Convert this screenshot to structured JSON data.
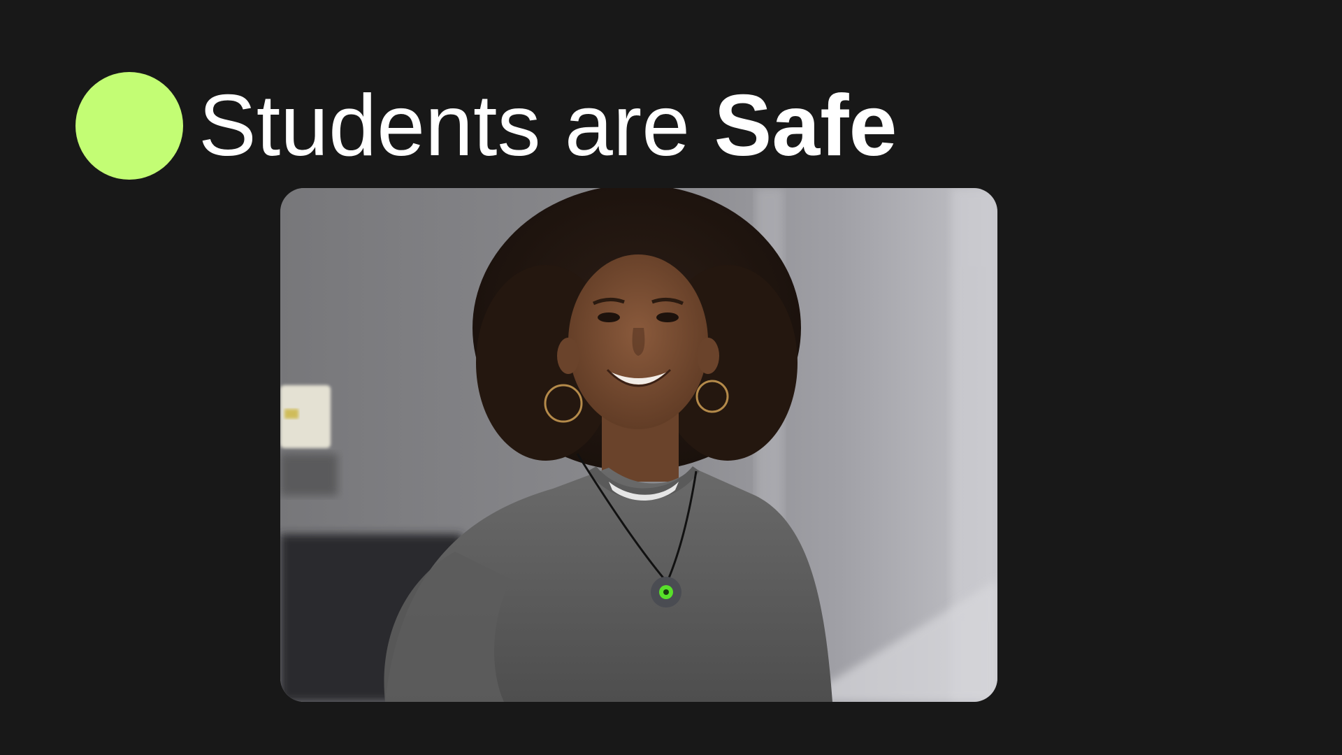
{
  "slide": {
    "title_regular": "Students are",
    "title_bold": "Safe"
  },
  "colors": {
    "background": "#181818",
    "accent": "#c3fd74",
    "title_text": "#ffffff",
    "pendant_light": "#58e02a"
  },
  "photo": {
    "subject": "smiling-student-wearing-pendant",
    "icon": "photo-icon"
  }
}
